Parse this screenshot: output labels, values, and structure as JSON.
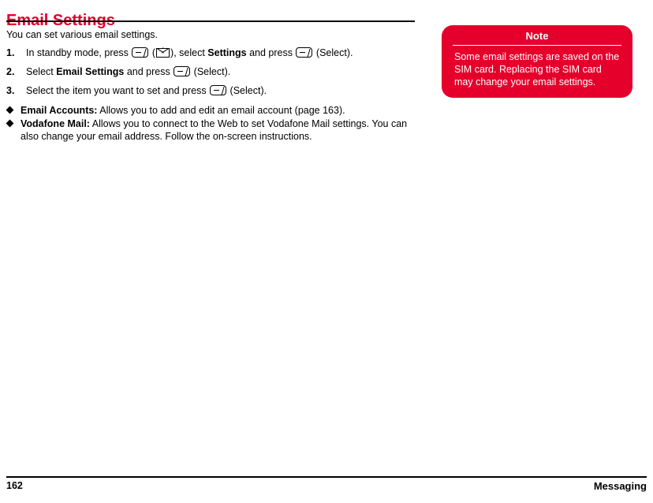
{
  "page": {
    "title": "Email Settings",
    "intro": "You can set various email settings.",
    "steps": [
      {
        "number": "1.",
        "segments": [
          {
            "type": "text",
            "text": "In standby mode, press "
          },
          {
            "type": "icon",
            "icon": "softkey-icon"
          },
          {
            "type": "text",
            "text": " ("
          },
          {
            "type": "icon",
            "icon": "envelope-icon"
          },
          {
            "type": "text",
            "text": "), select "
          },
          {
            "type": "bold",
            "text": "Settings"
          },
          {
            "type": "text",
            "text": " and press "
          },
          {
            "type": "icon",
            "icon": "softkey-icon"
          },
          {
            "type": "text",
            "text": " (Select)."
          }
        ]
      },
      {
        "number": "2.",
        "segments": [
          {
            "type": "text",
            "text": "Select "
          },
          {
            "type": "bold",
            "text": "Email Settings"
          },
          {
            "type": "text",
            "text": " and press "
          },
          {
            "type": "icon",
            "icon": "softkey-icon"
          },
          {
            "type": "text",
            "text": " (Select)."
          }
        ]
      },
      {
        "number": "3.",
        "segments": [
          {
            "type": "text",
            "text": "Select the item you want to set and press "
          },
          {
            "type": "icon",
            "icon": "softkey-icon"
          },
          {
            "type": "text",
            "text": " (Select)."
          }
        ]
      }
    ],
    "bullets": [
      {
        "term": "Email Accounts:",
        "description": "Allows you to add and edit an email account (page 163)."
      },
      {
        "term": "Vodafone Mail:",
        "description": "Allows you to connect to the Web to set Vodafone Mail settings. You can also change your email address. Follow the on-screen instructions."
      }
    ],
    "note": {
      "title": "Note",
      "body": "Some email settings are saved on the SIM card. Replacing the SIM card may change your email settings."
    },
    "footer": {
      "page_number": "162",
      "section": "Messaging"
    },
    "colors": {
      "accent": "#e4002b",
      "text": "#000000",
      "note_text": "#ffffff"
    }
  }
}
